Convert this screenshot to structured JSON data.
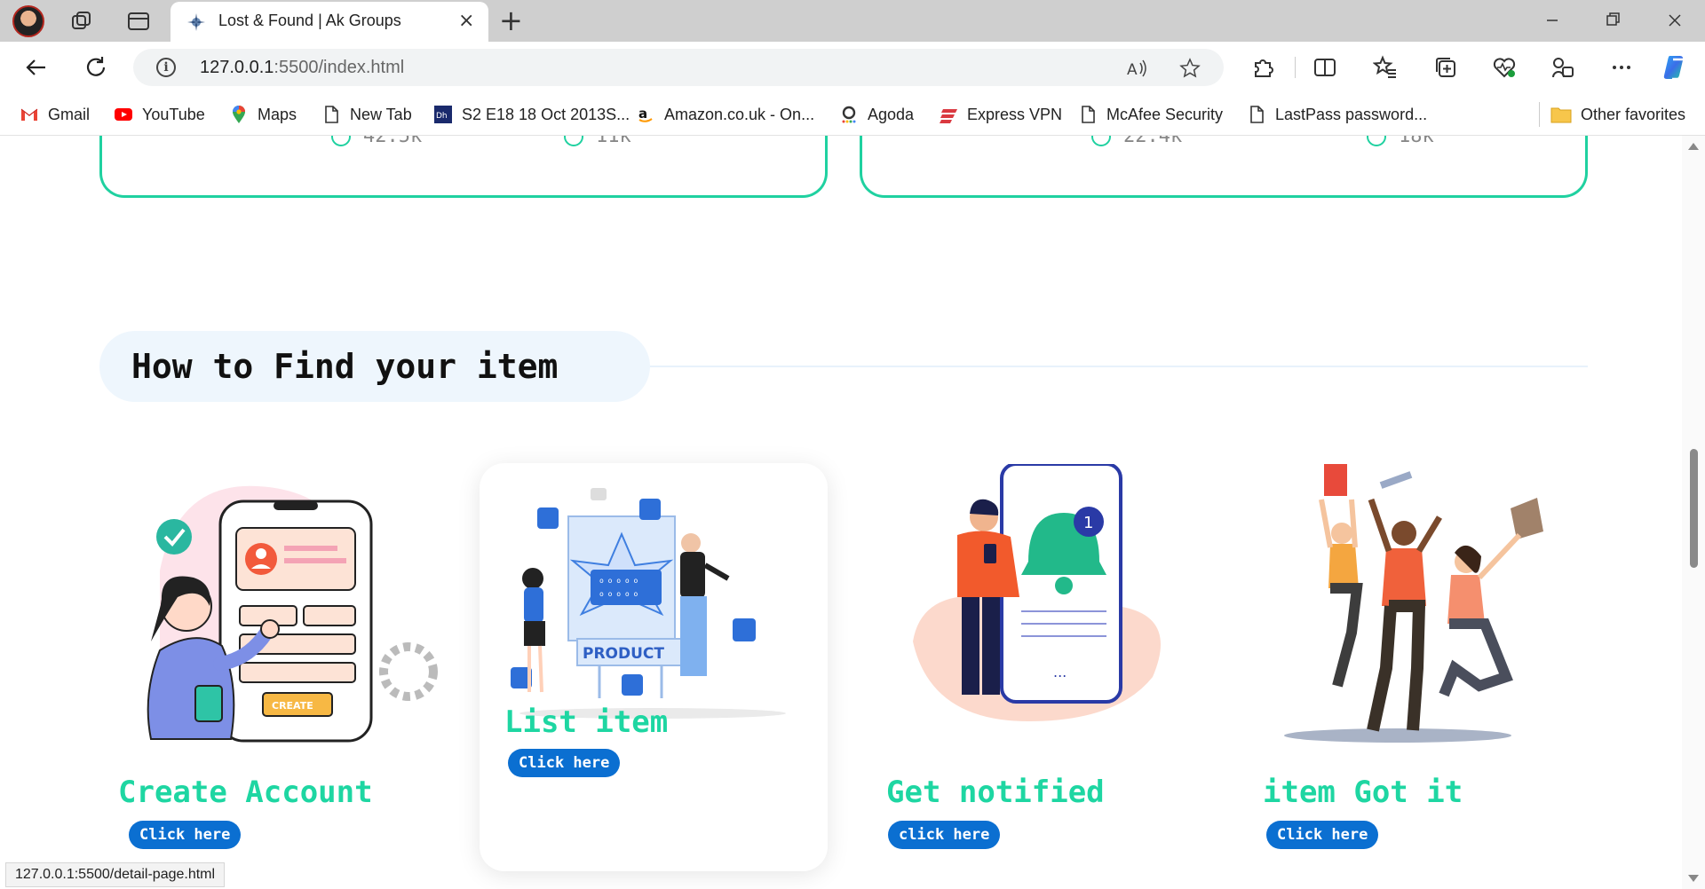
{
  "browser": {
    "tab": {
      "title": "Lost & Found | Ak Groups",
      "close": "×"
    },
    "new_tab": "+",
    "address": {
      "host": "127.0.0.1",
      "rest": ":5500/index.html"
    },
    "bookmarks": [
      {
        "label": "Gmail",
        "icon": "gmail-icon"
      },
      {
        "label": "YouTube",
        "icon": "youtube-icon"
      },
      {
        "label": "Maps",
        "icon": "maps-icon"
      },
      {
        "label": "New Tab",
        "icon": "page-icon"
      },
      {
        "label": "S2 E18 18 Oct 2013S...",
        "icon": "dh-icon"
      },
      {
        "label": "Amazon.co.uk - On...",
        "icon": "amazon-icon"
      },
      {
        "label": "Agoda",
        "icon": "agoda-icon"
      },
      {
        "label": "Express VPN",
        "icon": "expressvpn-icon"
      },
      {
        "label": "McAfee Security",
        "icon": "page-icon"
      },
      {
        "label": "LastPass password...",
        "icon": "page-icon"
      }
    ],
    "other_favorites": "Other favorites",
    "status_url": "127.0.0.1:5500/detail-page.html"
  },
  "stats": {
    "card1": {
      "views": "42.5k",
      "comments": "11k"
    },
    "card2": {
      "views": "22.4k",
      "comments": "18k"
    }
  },
  "section": {
    "title": "How to Find your item"
  },
  "steps": [
    {
      "title": "Create Account",
      "button": "Click here"
    },
    {
      "title": "List item",
      "button": "Click here"
    },
    {
      "title": "Get notified",
      "button": "click here"
    },
    {
      "title": "item Got it",
      "button": "Click here"
    }
  ],
  "colors": {
    "accent": "#1ed6a2",
    "button": "#0b6fd1",
    "card_border": "#1fd1a0"
  }
}
